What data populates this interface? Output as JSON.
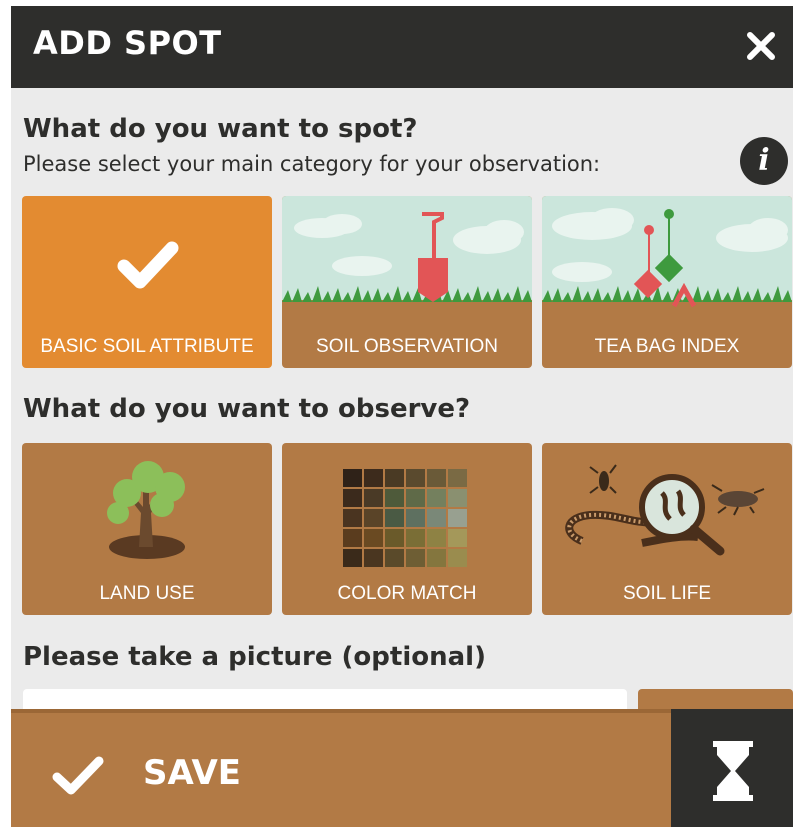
{
  "header": {
    "title": "ADD SPOT"
  },
  "spot_section": {
    "title": "What do you want to spot?",
    "subtitle": "Please select your main category for your observation:",
    "categories": [
      {
        "label": "BASIC SOIL ATTRIBUTE",
        "selected": true
      },
      {
        "label": "SOIL OBSERVATION",
        "selected": false
      },
      {
        "label": "TEA BAG INDEX",
        "selected": false
      }
    ]
  },
  "observe_section": {
    "title": "What do you want to observe?",
    "options": [
      {
        "label": "LAND USE"
      },
      {
        "label": "COLOR MATCH"
      },
      {
        "label": "SOIL LIFE"
      }
    ]
  },
  "picture_section": {
    "title": "Please take a picture (optional)"
  },
  "footer": {
    "save_label": "SAVE"
  },
  "colors": {
    "header": "#2e2e2c",
    "accent_selected": "#e38b31",
    "card_brown": "#b27a45",
    "background": "#ebebeb"
  },
  "icons": [
    "close-icon",
    "info-icon",
    "checkmark-icon",
    "hourglass-icon"
  ]
}
